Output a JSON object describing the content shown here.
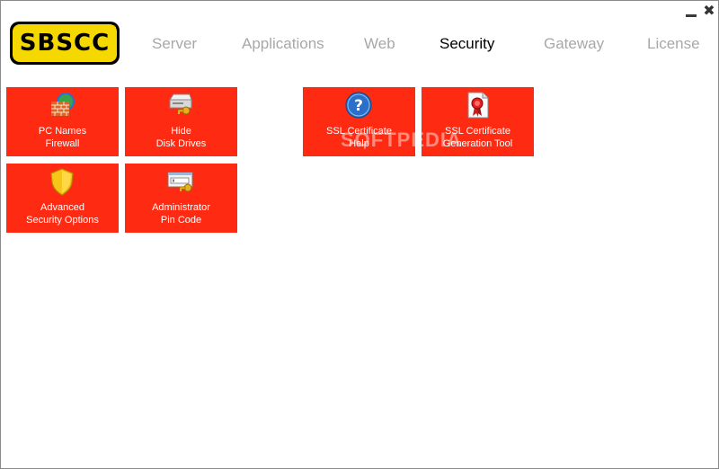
{
  "window": {
    "minimize_icon": "minimize-icon",
    "close_glyph": "✖"
  },
  "logo": {
    "text": "SBSCC",
    "registered": "®"
  },
  "tabs": [
    {
      "label": "Server",
      "active": false
    },
    {
      "label": "Applications",
      "active": false
    },
    {
      "label": "Web",
      "active": false
    },
    {
      "label": "Security",
      "active": true
    },
    {
      "label": "Gateway",
      "active": false
    },
    {
      "label": "License",
      "active": false
    }
  ],
  "tiles": {
    "pc_names_firewall": {
      "line1": "PC Names",
      "line2": "Firewall",
      "icon": "brick-firewall-globe-icon"
    },
    "hide_disk_drives": {
      "line1": "Hide",
      "line2": "Disk Drives",
      "icon": "disk-drive-key-icon"
    },
    "advanced_security": {
      "line1": "Advanced",
      "line2": "Security Options",
      "icon": "yellow-shield-icon"
    },
    "admin_pin_code": {
      "line1": "Administrator",
      "line2": "Pin Code",
      "icon": "pin-code-key-icon"
    },
    "ssl_help": {
      "line1": "SSL Certificate",
      "line2": "Help",
      "icon": "blue-question-icon"
    },
    "ssl_generation": {
      "line1": "SSL Certificate",
      "line2": "Generation Tool",
      "icon": "certificate-ribbon-icon"
    }
  },
  "watermark": "SOFTPEDIA",
  "colors": {
    "tile_bg": "#ff2a12",
    "logo_yellow": "#f5d800",
    "tab_inactive": "#a8a8a8",
    "tab_active": "#000000"
  }
}
